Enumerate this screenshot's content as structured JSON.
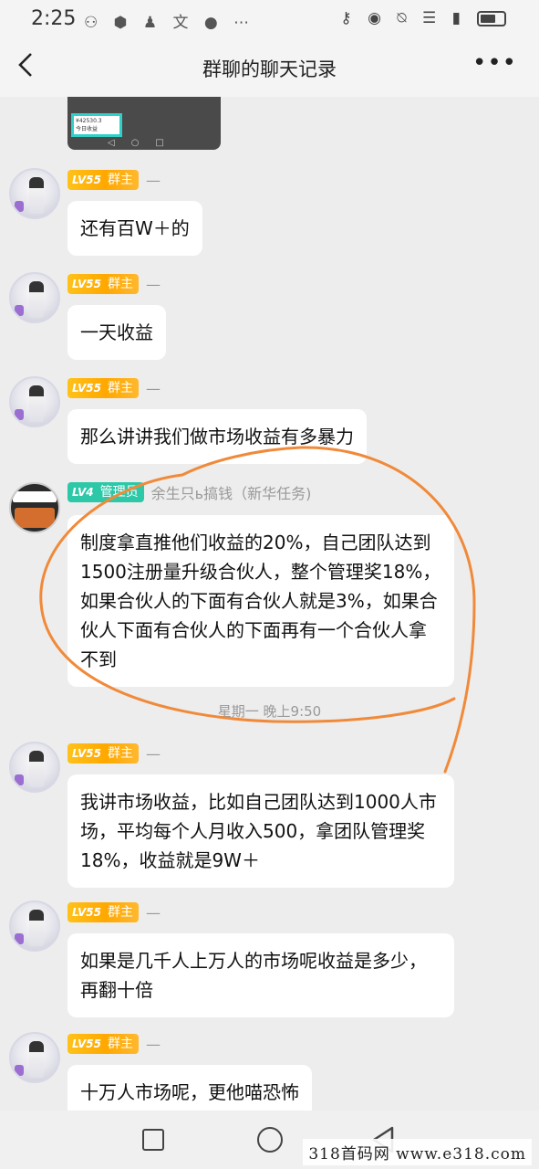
{
  "status_bar": {
    "time": "2:25",
    "left_icons": "⚇ ⬢ ♟ ⽂ ● ⋯",
    "right_icons": "⚷ ◉ ⍉ ☰ ▮",
    "battery_level": 0.65
  },
  "nav": {
    "back_icon": "chevron-left-icon",
    "title": "群聊的聊天记录",
    "more_label": "•••"
  },
  "image_message": {
    "card_text": "¥42530.3",
    "card_sub": "今日收益"
  },
  "messages": [
    {
      "level": "LV55",
      "role": "群主",
      "sender": "—",
      "text": "还有百W＋的"
    },
    {
      "level": "LV55",
      "role": "群主",
      "sender": "—",
      "text": "一天收益"
    },
    {
      "level": "LV55",
      "role": "群主",
      "sender": "—",
      "text": "那么讲讲我们做市场收益有多暴力"
    },
    {
      "level": "LV4",
      "role": "管理员",
      "sender": "余生只ь搞钱（新华任务)",
      "text": "制度拿直推他们收益的20%，自己团队达到1500注册量升级合伙人，整个管理奖18%，如果合伙人的下面有合伙人就是3%，如果合伙人下面有合伙人的下面再有一个合伙人拿不到"
    },
    {
      "level": "LV55",
      "role": "群主",
      "sender": "—",
      "text": "我讲市场收益，比如自己团队达到1000人市场，平均每个人月收入500，拿团队管理奖18%，收益就是9W＋"
    },
    {
      "level": "LV55",
      "role": "群主",
      "sender": "—",
      "text": "如果是几千人上万人的市场呢收益是多少，再翻十倍"
    },
    {
      "level": "LV55",
      "role": "群主",
      "sender": "—",
      "text": "十万人市场呢，更他喵恐怖"
    }
  ],
  "timestamp": "星期一 晚上9:50",
  "watermark": "318首码网 www.e318.com",
  "colors": {
    "owner_badge": "#ffb000",
    "admin_badge": "#2cc8a8",
    "annotation": "#f08a3a",
    "background": "#ededed"
  }
}
